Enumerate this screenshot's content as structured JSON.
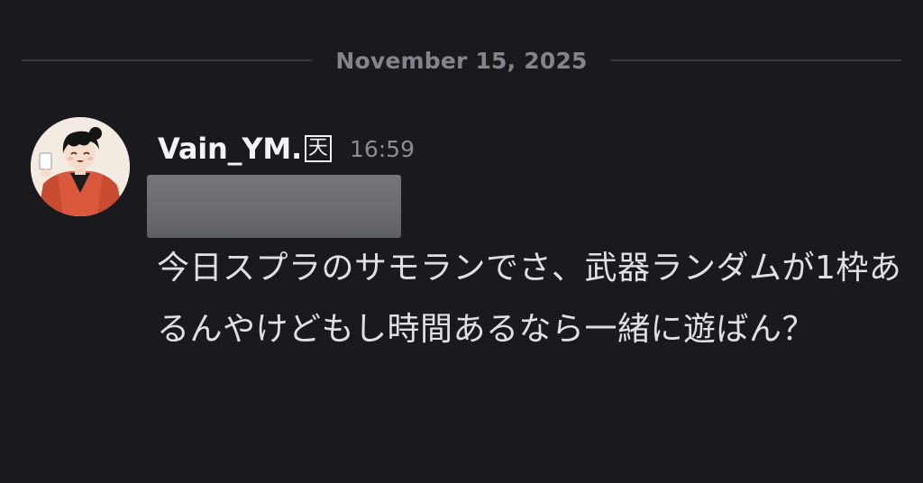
{
  "date_divider": "November 15, 2025",
  "message": {
    "author": "Vain_YM.",
    "author_tag": "天",
    "timestamp": "16:59",
    "text": "今日スプラのサモランでさ、武器ランダムが1枠あるんやけどもし時間あるなら一緒に遊ばん？"
  },
  "colors": {
    "background": "#1a1a1e",
    "username": "#f2f3f5",
    "muted": "#83848c",
    "message_text": "#dfe0e4",
    "redaction": "#6e6f73"
  },
  "icons": {
    "avatar": "user-avatar-illustration"
  }
}
